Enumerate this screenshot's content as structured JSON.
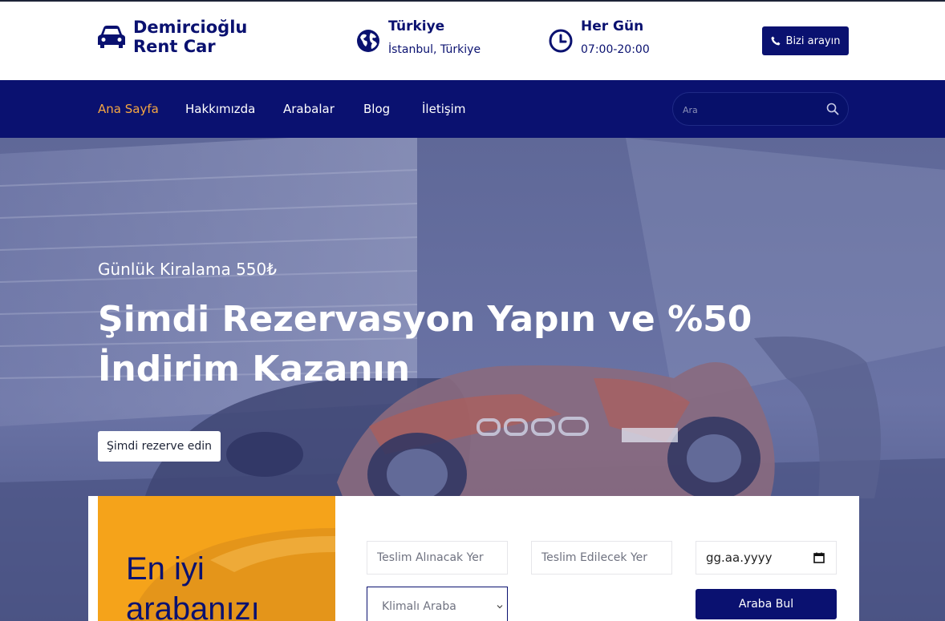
{
  "header": {
    "brand_line1": "Demircioğlu",
    "brand_line2": "Rent Car",
    "brand_icon": "car-icon",
    "location_title": "Türkiye",
    "location_sub": "İstanbul, Türkiye",
    "location_icon": "globe-icon",
    "hours_title": "Her Gün",
    "hours_sub": "07:00-20:00",
    "hours_icon": "clock-icon",
    "call_label": "Bizi arayın",
    "call_icon": "phone-icon"
  },
  "nav": {
    "items": [
      {
        "label": "Ana Sayfa",
        "active": true
      },
      {
        "label": "Hakkımızda"
      },
      {
        "label": "Arabalar"
      },
      {
        "label": "Blog"
      },
      {
        "label": "İletişim"
      }
    ],
    "search_placeholder": "Ara",
    "search_icon": "search-icon"
  },
  "hero": {
    "subtitle": "Günlük Kiralama 550₺",
    "title": "Şimdi Rezervasyon Yapın ve %50 İndirim Kazanın",
    "button": "Şimdi rezerve edin"
  },
  "booking": {
    "promo_line1": "En iyi",
    "promo_line2": "arabanızı",
    "pickup_placeholder": "Teslim Alınacak Yer",
    "dropoff_placeholder": "Teslim Edilecek Yer",
    "date_placeholder": "gg.aa.yyyy",
    "date_icon": "calendar-icon",
    "car_type_selected": "Klimalı Araba",
    "car_type_icon": "chevron-down-icon",
    "find_button": "Araba Bul"
  },
  "colors": {
    "primary": "#0a1170",
    "accent": "#f5a742",
    "promo": "#f5a31a"
  }
}
